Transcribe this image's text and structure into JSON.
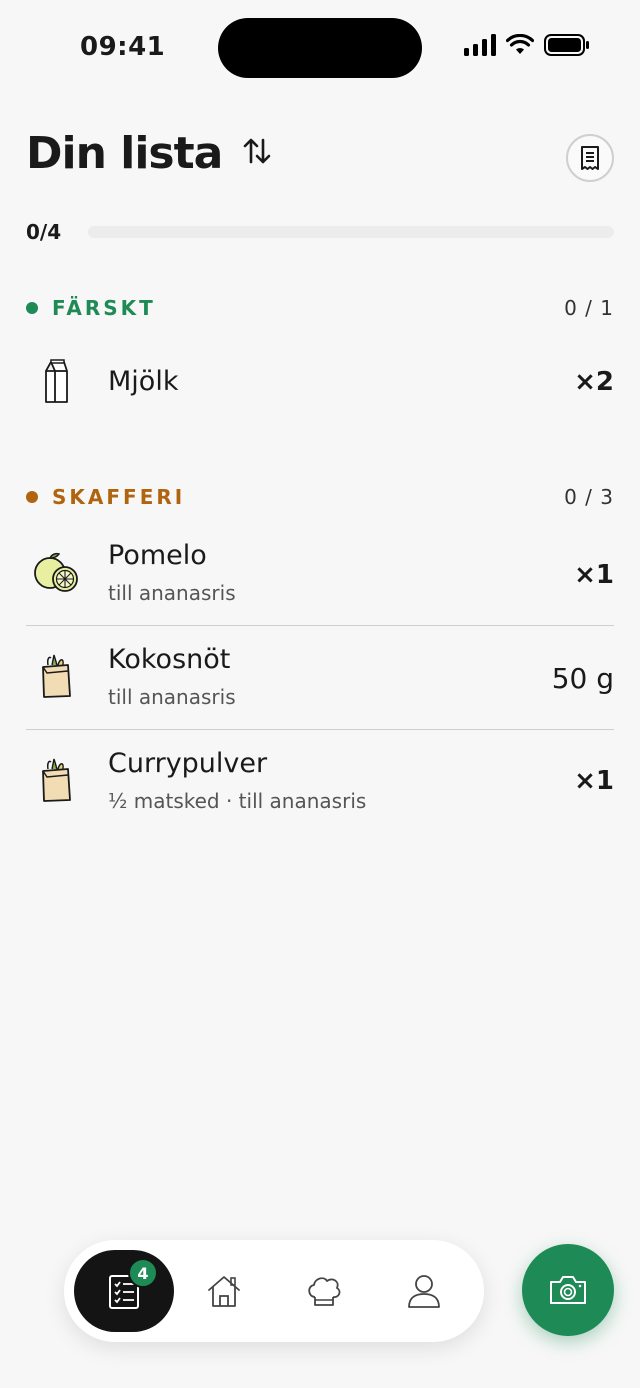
{
  "status_bar": {
    "time": "09:41"
  },
  "header": {
    "title": "Din lista"
  },
  "progress": {
    "label": "0/4",
    "done": 0,
    "total": 4
  },
  "colors": {
    "accent": "#1e8a56",
    "fresh": "#1e8a56",
    "pantry": "#b0640f"
  },
  "sections": [
    {
      "title": "FÄRSKT",
      "count": "0 / 1",
      "items": [
        {
          "name": "Mjölk",
          "subtitle": "",
          "quantity": "×2",
          "icon": "milk-carton-icon"
        }
      ]
    },
    {
      "title": "SKAFFERI",
      "count": "0 / 3",
      "items": [
        {
          "name": "Pomelo",
          "subtitle": "till ananasris",
          "quantity": "×1",
          "icon": "citrus-icon"
        },
        {
          "name": "Kokosnöt",
          "subtitle": "till ananasris",
          "quantity": "50 g",
          "icon": "grocery-bag-icon"
        },
        {
          "name": "Currypulver",
          "subtitle": "½ matsked · till ananasris",
          "quantity": "×1",
          "icon": "grocery-bag-icon"
        }
      ]
    }
  ],
  "nav": {
    "badge": "4",
    "items": [
      "list-icon",
      "home-icon",
      "chef-hat-icon",
      "profile-icon"
    ]
  },
  "fab": {
    "icon": "camera-icon"
  }
}
